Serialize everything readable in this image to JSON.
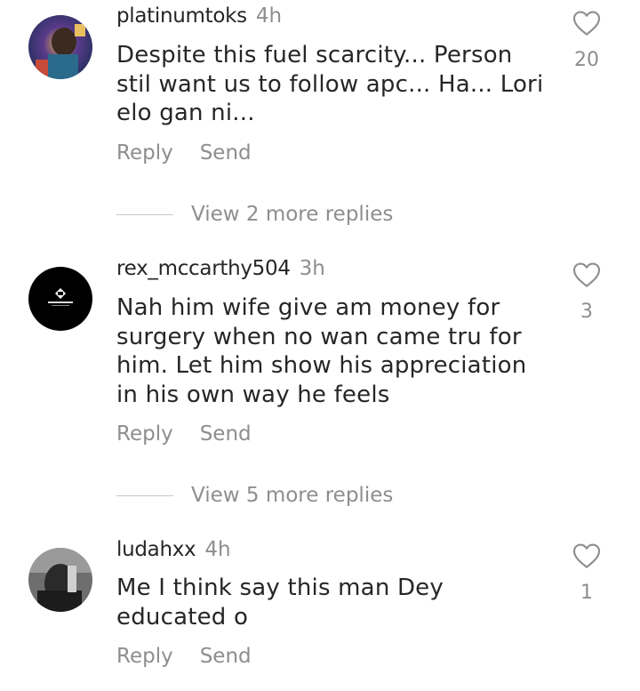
{
  "comments": [
    {
      "username": "platinumtoks",
      "time": "4h",
      "text": "Despite this fuel scarcity... Person stil want us to follow apc... Ha... Lori elo gan ni...",
      "reply_label": "Reply",
      "send_label": "Send",
      "likes": "20",
      "view_replies": "View 2 more replies"
    },
    {
      "username": "rex_mccarthy504",
      "time": "3h",
      "text": "Nah him wife give am money for surgery when no wan came tru for him. Let him show his appreciation in his own way he feels",
      "reply_label": "Reply",
      "send_label": "Send",
      "likes": "3",
      "view_replies": "View 5 more replies"
    },
    {
      "username": "ludahxx",
      "time": "4h",
      "text": "Me I think say this man Dey educated o",
      "reply_label": "Reply",
      "send_label": "Send",
      "likes": "1"
    }
  ],
  "icons": {
    "like": "heart-outline-icon"
  },
  "colors": {
    "primary_text": "#262626",
    "secondary_text": "#8e8e8e",
    "divider": "#c7c7c7"
  }
}
